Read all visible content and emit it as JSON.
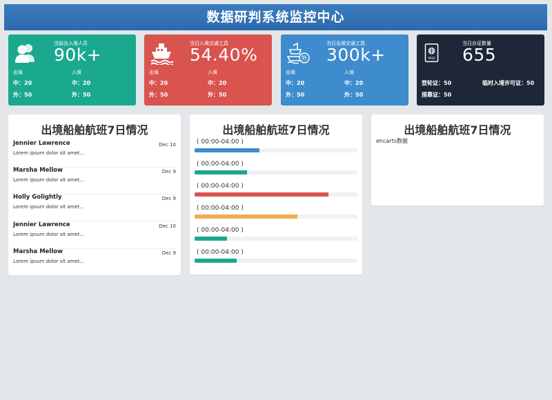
{
  "header": {
    "title": "数据研判系统监控中心"
  },
  "cards": [
    {
      "caption": "当前出入境人员",
      "value": "90k+",
      "icon": "people-icon",
      "color": "#1aa98f",
      "left_label": "出境",
      "right_label": "入境",
      "left_rows": [
        "中：20",
        "外：50"
      ],
      "right_rows": [
        "中：20",
        "外：50"
      ]
    },
    {
      "caption": "当日入境交通工具",
      "value": "54.40%",
      "icon": "ship-icon",
      "color": "#d9534f",
      "left_label": "出境",
      "right_label": "入境",
      "left_rows": [
        "中：20",
        "外：50"
      ],
      "right_rows": [
        "中：20",
        "外：50"
      ]
    },
    {
      "caption": "当日出境交通工具",
      "value": "300k+",
      "icon": "foreign-ship-icon",
      "color": "#3e8ccd",
      "left_label": "出境",
      "right_label": "入境",
      "left_rows": [
        "中：20",
        "外：50"
      ],
      "right_rows": [
        "中：20",
        "外：50"
      ]
    },
    {
      "caption": "当日办证数量",
      "value": "655",
      "icon": "passport-icon",
      "color": "#1d2738",
      "rows": [
        "登轮证：50",
        "临时入境许可证：50",
        "搭靠证：50"
      ]
    }
  ],
  "panels": {
    "messages": {
      "title": "出境船舶航班7日情况",
      "items": [
        {
          "name": "Jennier Lawrence",
          "date": "Dec 10",
          "text": "Lorem ipsum dolor sit amet..."
        },
        {
          "name": "Marsha Mellow",
          "date": "Dec 9",
          "text": "Lorem ipsum dolor sit amet..."
        },
        {
          "name": "Holly Golightly",
          "date": "Dec 9",
          "text": "Lorem ipsum dolor sit amet..."
        },
        {
          "name": "Jennier Lawrence",
          "date": "Dec 10",
          "text": "Lorem ipsum dolor sit amet..."
        },
        {
          "name": "Marsha Mellow",
          "date": "Dec 9",
          "text": "Lorem ipsum dolor sit amet..."
        }
      ]
    },
    "progress": {
      "title": "出境船舶航班7日情况",
      "items": [
        {
          "label": "( 00:00-04:00 )",
          "percent": 40,
          "color": "#3e8ccd"
        },
        {
          "label": "( 00:00-04:00 )",
          "percent": 32,
          "color": "#1aa98f"
        },
        {
          "label": "( 00:00-04:00 )",
          "percent": 82,
          "color": "#d9534f"
        },
        {
          "label": "( 00:00-04:00 )",
          "percent": 63,
          "color": "#f0ad4e"
        },
        {
          "label": "( 00:00-04:00 )",
          "percent": 20,
          "color": "#1aa98f"
        },
        {
          "label": "( 00:00-04:00 )",
          "percent": 26,
          "color": "#1aa98f"
        }
      ]
    },
    "echart": {
      "title": "出境船舶航班7日情况",
      "placeholder": "ehcarts数据"
    }
  }
}
